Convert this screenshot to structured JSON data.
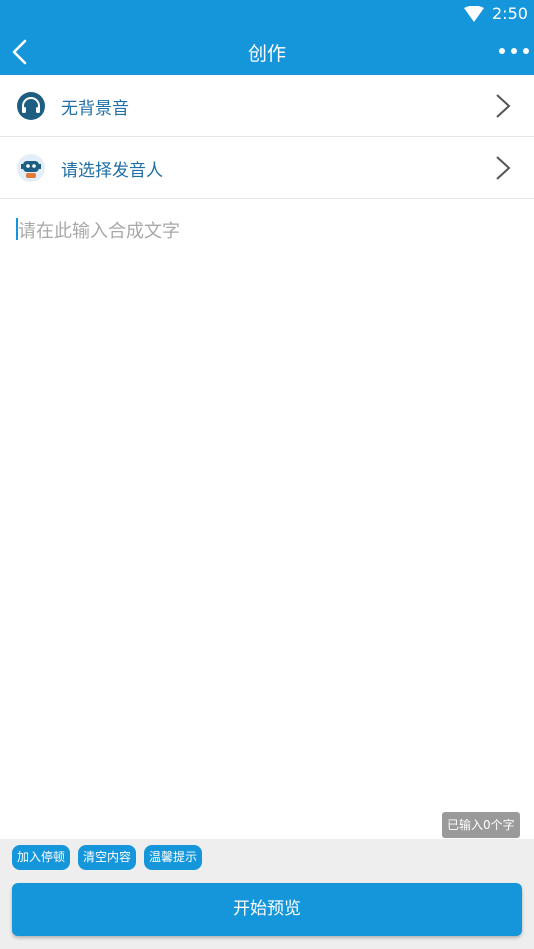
{
  "status_bar": {
    "time": "2:50",
    "wifi_icon": "wifi-icon"
  },
  "app_bar": {
    "title": "创作",
    "back_icon": "chevron-left-icon",
    "more_icon": "more-dots-icon"
  },
  "rows": [
    {
      "label": "无背景音",
      "icon": "headphones-icon"
    },
    {
      "label": "请选择发音人",
      "icon": "robot-icon"
    }
  ],
  "editor": {
    "placeholder": "请在此输入合成文字",
    "value": ""
  },
  "counter": "已输入0个字",
  "chips": [
    "加入停顿",
    "清空内容",
    "温馨提示"
  ],
  "start_button": "开始预览",
  "colors": {
    "primary": "#1596db",
    "link_text": "#1f6fa6",
    "background_bottom": "#eeeeee"
  }
}
